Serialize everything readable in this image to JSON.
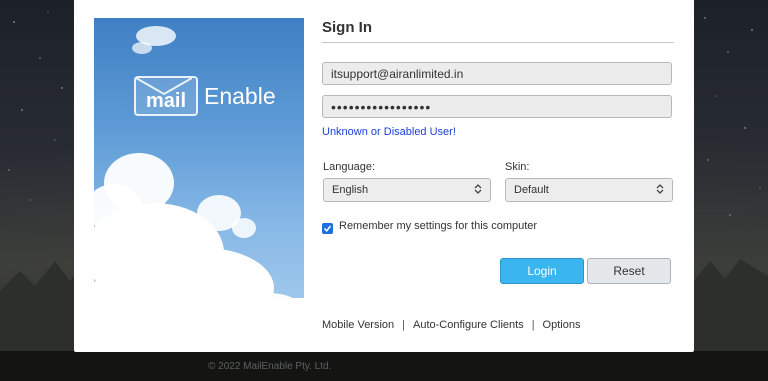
{
  "brand": {
    "logo_mail": "mail",
    "logo_enable": "Enable"
  },
  "signin": {
    "title": "Sign In",
    "username": "itsupport@airanlimited.in",
    "password_mask": "•••••••••••••••••",
    "error": "Unknown or Disabled User!"
  },
  "language": {
    "label": "Language:",
    "value": "English"
  },
  "skin": {
    "label": "Skin:",
    "value": "Default"
  },
  "remember": {
    "label": "Remember my settings for this computer",
    "checked": true
  },
  "buttons": {
    "login": "Login",
    "reset": "Reset"
  },
  "links": {
    "mobile": "Mobile Version",
    "autoconfig": "Auto-Configure Clients",
    "options": "Options",
    "separator": "|"
  },
  "footer": {
    "copyright": "© 2022 MailEnable Pty. Ltd."
  },
  "colors": {
    "login_button": "#3ab5ef",
    "error_text": "#1a3fd9",
    "checkbox": "#1f6fe0"
  },
  "icons": {
    "select_chevron": "chevron-up-down-icon",
    "checkbox": "checkmark-icon",
    "logo": "envelope-icon"
  }
}
